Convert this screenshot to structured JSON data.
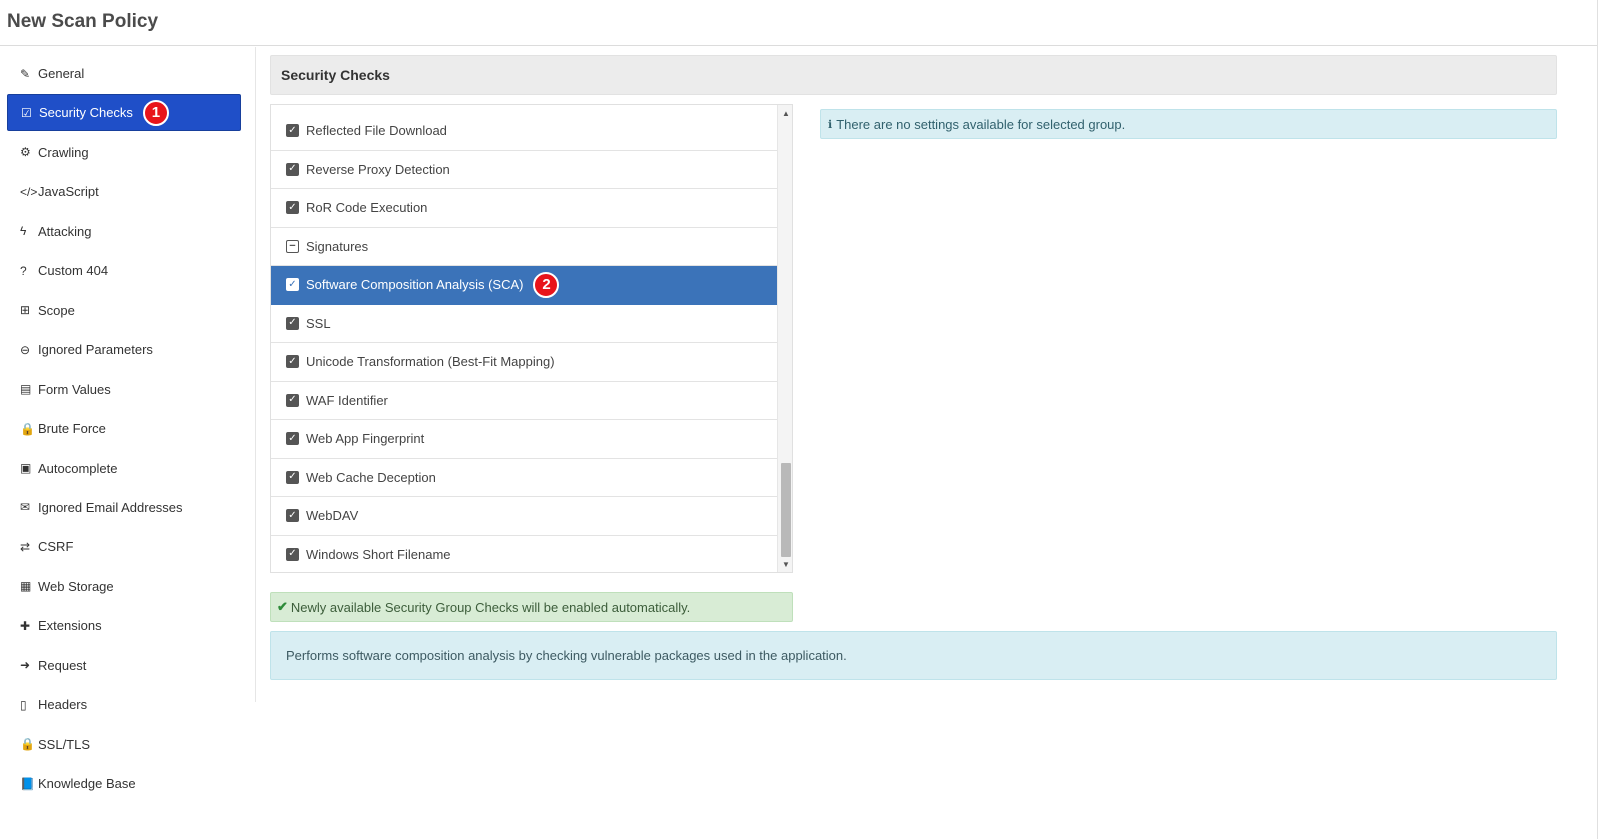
{
  "header": {
    "title": "New Scan Policy"
  },
  "sidebar": {
    "items": [
      {
        "label": "General",
        "icon": "✎"
      },
      {
        "label": "Security Checks",
        "icon": "☑",
        "active": true,
        "badge": "1"
      },
      {
        "label": "Crawling",
        "icon": "⚙"
      },
      {
        "label": "JavaScript",
        "icon": "</>"
      },
      {
        "label": "Attacking",
        "icon": "ϟ"
      },
      {
        "label": "Custom 404",
        "icon": "?"
      },
      {
        "label": "Scope",
        "icon": "⊞"
      },
      {
        "label": "Ignored Parameters",
        "icon": "⊖"
      },
      {
        "label": "Form Values",
        "icon": "▤"
      },
      {
        "label": "Brute Force",
        "icon": "🔒"
      },
      {
        "label": "Autocomplete",
        "icon": "▣"
      },
      {
        "label": "Ignored Email Addresses",
        "icon": "✉"
      },
      {
        "label": "CSRF",
        "icon": "⇄"
      },
      {
        "label": "Web Storage",
        "icon": "▦"
      },
      {
        "label": "Extensions",
        "icon": "✚"
      },
      {
        "label": "Request",
        "icon": "➜"
      },
      {
        "label": "Headers",
        "icon": "▯"
      },
      {
        "label": "SSL/TLS",
        "icon": "🔒"
      },
      {
        "label": "Knowledge Base",
        "icon": "📘"
      }
    ]
  },
  "panel": {
    "title": "Security Checks"
  },
  "checks": [
    {
      "label": "Reflected File Download",
      "state": "checked"
    },
    {
      "label": "Reverse Proxy Detection",
      "state": "checked"
    },
    {
      "label": "RoR Code Execution",
      "state": "checked"
    },
    {
      "label": "Signatures",
      "state": "indeterminate"
    },
    {
      "label": "Software Composition Analysis (SCA)",
      "state": "checked",
      "selected": true,
      "badge": "2"
    },
    {
      "label": "SSL",
      "state": "checked"
    },
    {
      "label": "Unicode Transformation (Best-Fit Mapping)",
      "state": "checked"
    },
    {
      "label": "WAF Identifier",
      "state": "checked"
    },
    {
      "label": "Web App Fingerprint",
      "state": "checked"
    },
    {
      "label": "Web Cache Deception",
      "state": "checked"
    },
    {
      "label": "WebDAV",
      "state": "checked"
    },
    {
      "label": "Windows Short Filename",
      "state": "checked"
    }
  ],
  "info": {
    "text": "There are no settings available for selected group."
  },
  "success": {
    "text": "Newly available Security Group Checks will be enabled automatically."
  },
  "description": {
    "text": "Performs software composition analysis by checking vulnerable packages used in the application."
  }
}
